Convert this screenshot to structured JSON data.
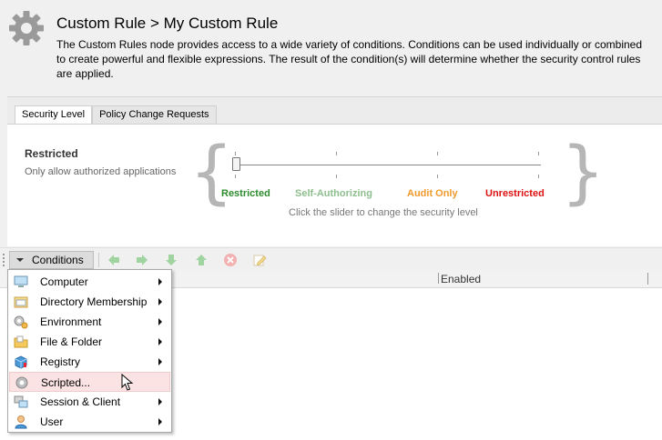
{
  "header": {
    "title": "Custom Rule > My Custom Rule",
    "description": "The Custom Rules node provides access to a wide variety of conditions. Conditions can be used individually or combined to create powerful and flexible expressions. The result of the condition(s) will determine whether the security control rules are applied.",
    "icon": "gear-icon"
  },
  "tabs": [
    {
      "label": "Security Level",
      "active": true
    },
    {
      "label": "Policy Change Requests",
      "active": false
    }
  ],
  "security_level": {
    "current_title": "Restricted",
    "current_description": "Only allow authorized applications",
    "levels": [
      {
        "label": "Restricted",
        "color": "#2e8b2e"
      },
      {
        "label": "Self-Authorizing",
        "color": "#8fbf8f"
      },
      {
        "label": "Audit Only",
        "color": "#f09a2c"
      },
      {
        "label": "Unrestricted",
        "color": "#dd1111"
      }
    ],
    "hint": "Click the slider to change the security level",
    "selected_index": 0
  },
  "toolbar": {
    "conditions_label": "Conditions",
    "icons": [
      "arrow-left-icon",
      "arrow-right-icon",
      "arrow-down-icon",
      "arrow-up-icon",
      "delete-icon",
      "edit-icon"
    ]
  },
  "grid": {
    "columns": [
      "Enabled"
    ]
  },
  "menu": {
    "items": [
      {
        "label": "Computer",
        "icon": "computer-icon",
        "submenu": true
      },
      {
        "label": "Directory Membership",
        "icon": "directory-icon",
        "submenu": true
      },
      {
        "label": "Environment",
        "icon": "environment-icon",
        "submenu": true
      },
      {
        "label": "File & Folder",
        "icon": "folder-icon",
        "submenu": true
      },
      {
        "label": "Registry",
        "icon": "registry-icon",
        "submenu": true
      },
      {
        "label": "Scripted...",
        "icon": "script-icon",
        "submenu": false,
        "hover": true
      },
      {
        "label": "Session & Client",
        "icon": "session-icon",
        "submenu": true
      },
      {
        "label": "User",
        "icon": "user-icon",
        "submenu": true
      }
    ]
  }
}
